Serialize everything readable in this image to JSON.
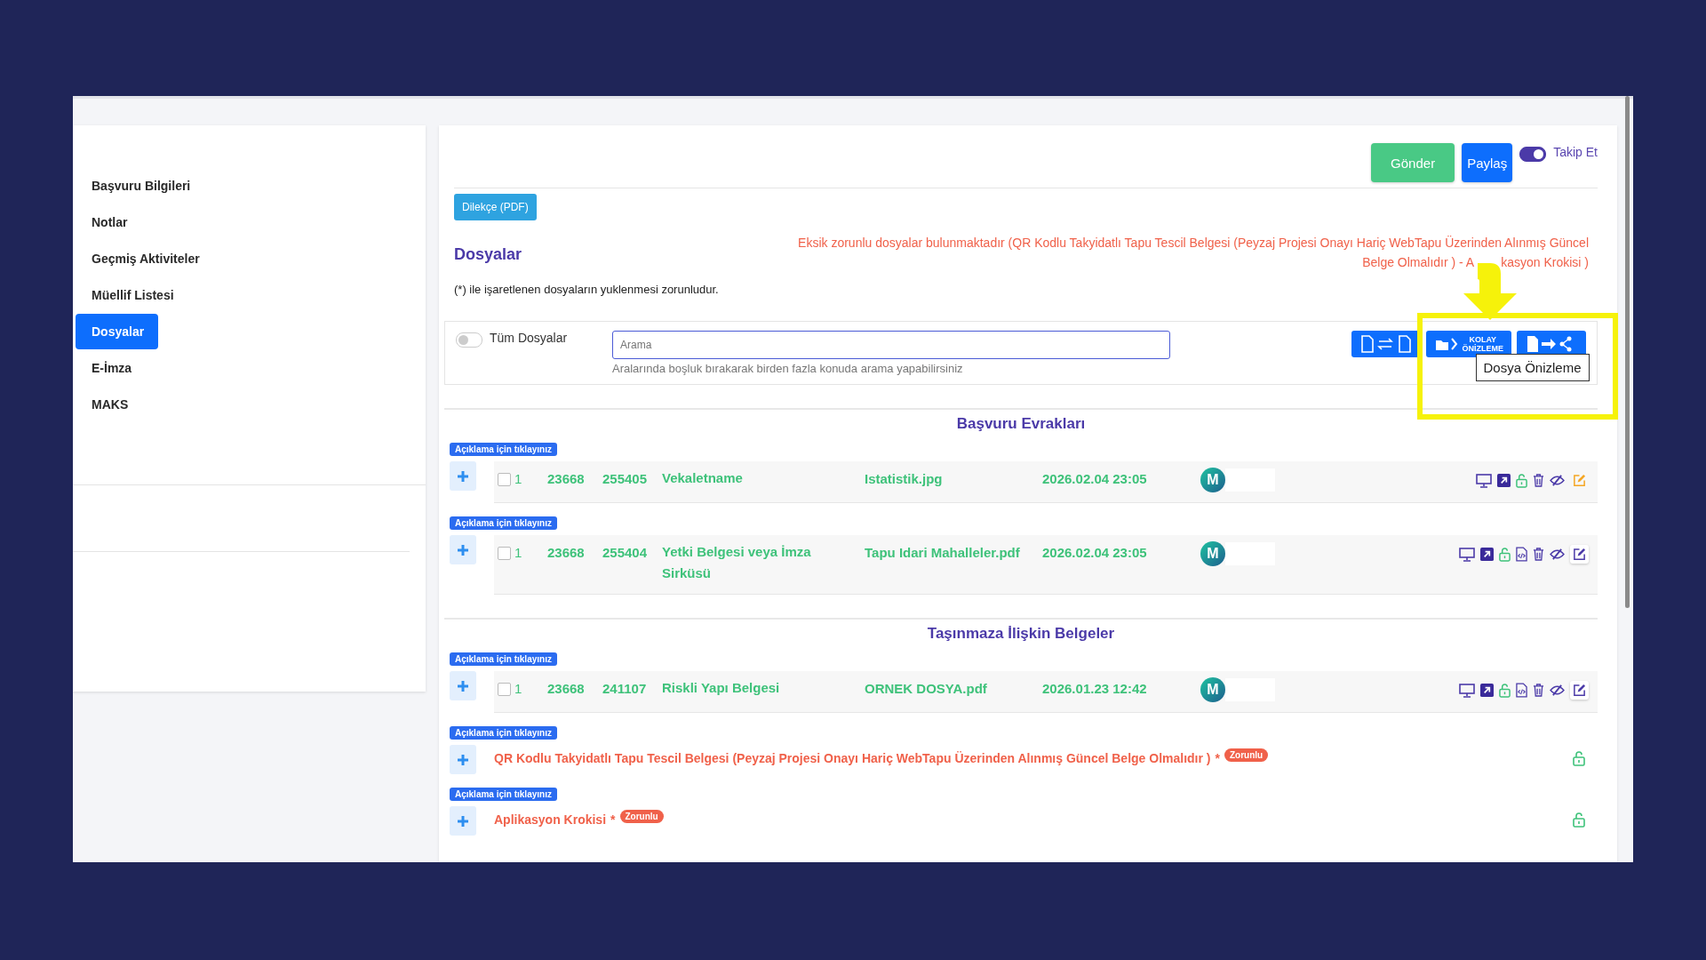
{
  "sidebar": {
    "items": [
      {
        "label": "Başvuru Bilgileri",
        "selected": false
      },
      {
        "label": "Notlar",
        "selected": false
      },
      {
        "label": "Geçmiş Aktiviteler",
        "selected": false
      },
      {
        "label": "Müellif Listesi",
        "selected": false
      },
      {
        "label": "Dosyalar",
        "selected": true
      },
      {
        "label": "E-İmza",
        "selected": false
      },
      {
        "label": "MAKS",
        "selected": false
      }
    ]
  },
  "header": {
    "buttons": [
      {
        "label": "Gönder",
        "kind": "success"
      },
      {
        "label": "Paylaş",
        "kind": "primary"
      }
    ],
    "follow": {
      "label": "Takip Et",
      "on": true
    }
  },
  "petition_button": "Dilekçe (PDF)",
  "title": "Dosyalar",
  "warning_parts": [
    "Eksik zorunlu dosyalar bulunmaktadır (QR Kodlu Takyidatlı Tapu Tescil Belgesi (Peyzaj Projesi Onayı Hariç WebTapu Üzerinden Alınmış Güncel",
    "Belge Olmalıdır ) - A",
    "kasyon Krokisi )"
  ],
  "required_note": "(*) ile işaretlenen dosyaların yuklenmesi zorunludur.",
  "filter": {
    "all_files": {
      "label": "Tüm Dosyalar",
      "on": false
    },
    "search": {
      "placeholder": "Arama"
    },
    "hint": "Aralarında boşluk bırakarak birden fazla konuda arama yapabilirsiniz",
    "preview_button": {
      "label_lines": [
        "KOLAY",
        "ÖNİZLEME"
      ]
    }
  },
  "tooltip": "Dosya Önizleme",
  "sections": [
    {
      "title": "Başvuru Evrakları",
      "rows": [
        {
          "kind": "file",
          "note_label": "Açıklama için tıklayınız",
          "checked": false,
          "index": "1",
          "app_no": "23668",
          "doc_no": "255405",
          "name": "Vekaletname",
          "file": "Istatistik.jpg",
          "date": "2026.02.04 23:05",
          "avatar": "M",
          "code_view": false,
          "edit_highlighted": true
        },
        {
          "kind": "file",
          "note_label": "Açıklama için tıklayınız",
          "checked": false,
          "index": "1",
          "app_no": "23668",
          "doc_no": "255404",
          "name": "Yetki Belgesi veya İmza Sirküsü",
          "file": "Tapu Idari Mahalleler.pdf",
          "date": "2026.02.04 23:05",
          "avatar": "M",
          "code_view": true,
          "edit_highlighted": false
        }
      ]
    },
    {
      "title": "Taşınmaza İlişkin Belgeler",
      "rows": [
        {
          "kind": "file",
          "note_label": "Açıklama için tıklayınız",
          "checked": false,
          "index": "1",
          "app_no": "23668",
          "doc_no": "241107",
          "name": "Riskli Yapı Belgesi",
          "file": "ORNEK DOSYA.pdf",
          "date": "2026.01.23 12:42",
          "avatar": "M",
          "code_view": true,
          "edit_highlighted": false
        },
        {
          "kind": "missing",
          "note_label": "Açıklama için tıklayınız",
          "name": "QR Kodlu Takyidatlı Tapu Tescil Belgesi (Peyzaj Projesi Onayı Hariç WebTapu Üzerinden Alınmış Güncel Belge Olmalıdır )",
          "star": "*",
          "tag": "Zorunlu"
        },
        {
          "kind": "missing",
          "note_label": "Açıklama için tıklayınız",
          "name": "Aplikasyon Krokisi",
          "star": "*",
          "tag": "Zorunlu"
        }
      ]
    }
  ]
}
